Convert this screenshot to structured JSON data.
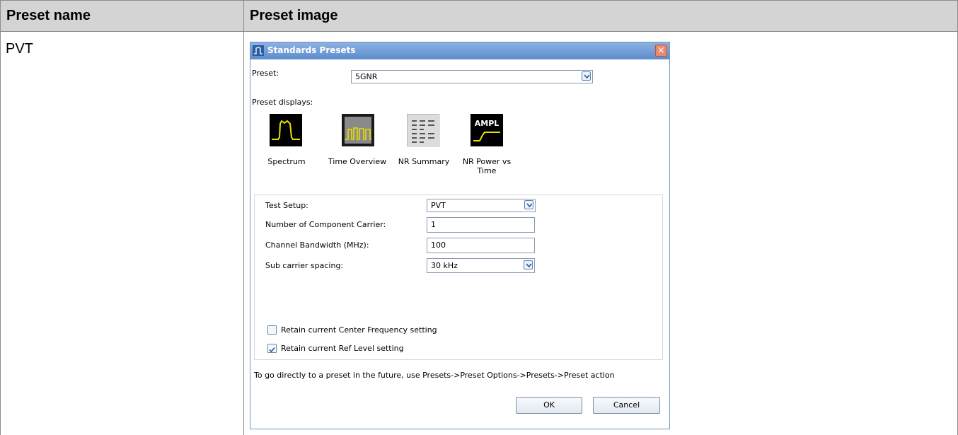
{
  "table": {
    "header": {
      "col1": "Preset name",
      "col2": "Preset image"
    },
    "row": {
      "name": "PVT"
    }
  },
  "dialog": {
    "title": "Standards Presets",
    "preset_label": "Preset:",
    "preset_value": "5GNR",
    "displays_label": "Preset displays:",
    "displays": [
      {
        "label": "Spectrum",
        "icon": "spectrum-icon"
      },
      {
        "label": "Time Overview",
        "icon": "time-overview-icon"
      },
      {
        "label": "NR Summary",
        "icon": "nr-summary-icon"
      },
      {
        "label": "NR Power vs Time",
        "icon": "nr-power-vs-time-icon",
        "icon_text": "AMPL"
      }
    ],
    "settings": {
      "test_setup_label": "Test Setup:",
      "test_setup_value": "PVT",
      "carriers_label": "Number of Component Carrier:",
      "carriers_value": "1",
      "bandwidth_label": "Channel Bandwidth (MHz):",
      "bandwidth_value": "100",
      "spacing_label": "Sub carrier spacing:",
      "spacing_value": "30 kHz"
    },
    "checkboxes": {
      "center_freq_label": "Retain current Center Frequency setting",
      "center_freq_checked": false,
      "ref_level_label": "Retain current Ref Level setting",
      "ref_level_checked": true
    },
    "note": "To go directly to a preset in the future, use Presets->Preset Options->Presets->Preset action",
    "ok_label": "OK",
    "cancel_label": "Cancel"
  },
  "colors": {
    "titlebar": "#5c8ccd",
    "trace_yellow": "#e8e000",
    "header_bg": "#d4d4d4"
  }
}
